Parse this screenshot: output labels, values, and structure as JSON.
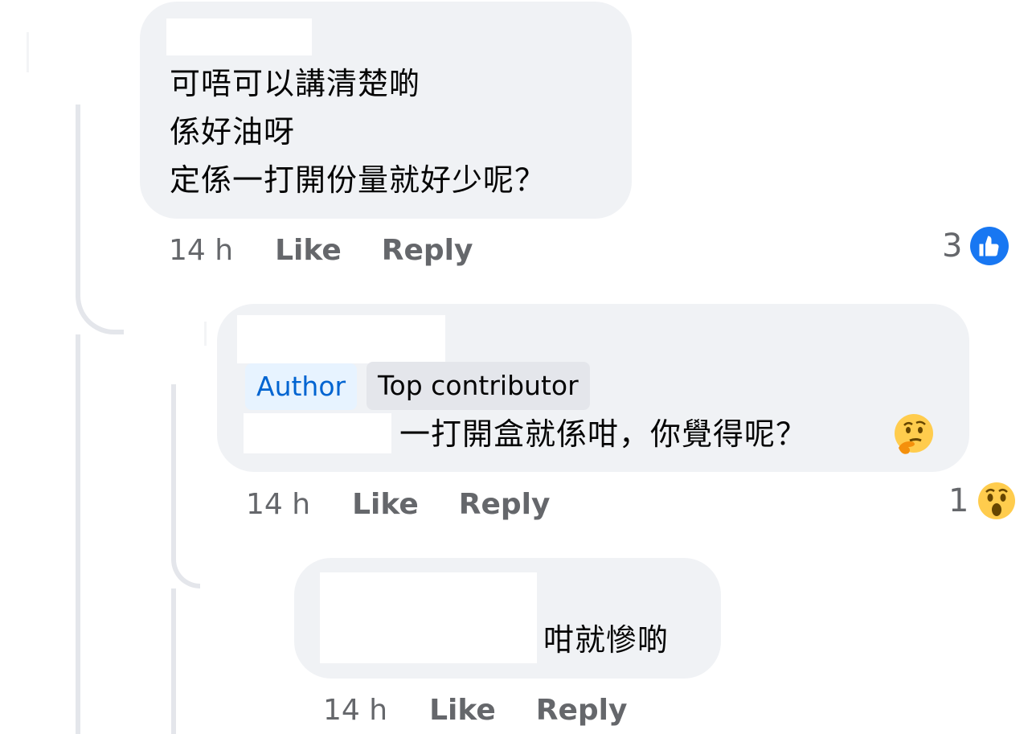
{
  "comments": [
    {
      "text_lines": [
        "可唔可以講清楚啲",
        "係好油呀",
        "定係一打開份量就好少呢？"
      ],
      "time": "14 h",
      "like_label": "Like",
      "reply_label": "Reply",
      "reaction_count": "3",
      "reaction_icon": "like-icon"
    },
    {
      "badges": {
        "author": "Author",
        "top_contributor": "Top contributor"
      },
      "text": "一打開盒就係咁，你覺得呢？",
      "text_emoji": "thinking-face-emoji",
      "time": "14 h",
      "like_label": "Like",
      "reply_label": "Reply",
      "reaction_count": "1",
      "reaction_icon": "wow-face-icon"
    },
    {
      "text": "咁就慘啲",
      "time": "14 h",
      "like_label": "Like",
      "reply_label": "Reply"
    }
  ],
  "colors": {
    "bubble": "#f0f2f5",
    "author_badge_bg": "#e7f3ff",
    "author_badge_text": "#0064d1",
    "top_badge_bg": "#e4e6eb",
    "meta_text": "#65676b",
    "like_blue": "#1877f2",
    "emoji_yellow": "#ffcc4d"
  }
}
